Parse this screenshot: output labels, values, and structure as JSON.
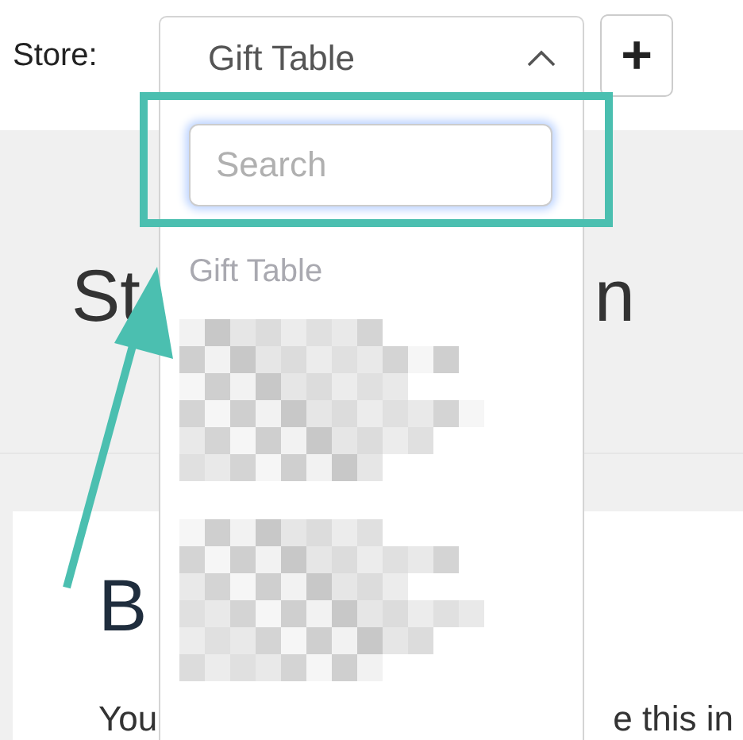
{
  "store_bar": {
    "label": "Store:",
    "select": {
      "value": "Gift Table",
      "expanded": true
    },
    "add_button": {
      "label": "+"
    }
  },
  "dropdown": {
    "search": {
      "placeholder": "Search",
      "focused": true
    },
    "options": [
      {
        "kind": "group",
        "label": "Gift Table",
        "disabled": true
      },
      {
        "kind": "redacted"
      },
      {
        "kind": "redacted"
      }
    ]
  },
  "page": {
    "heading_parts": [
      "St",
      "n"
    ],
    "card": {
      "title": "B",
      "text_parts": [
        "You",
        "e this in"
      ]
    }
  }
}
